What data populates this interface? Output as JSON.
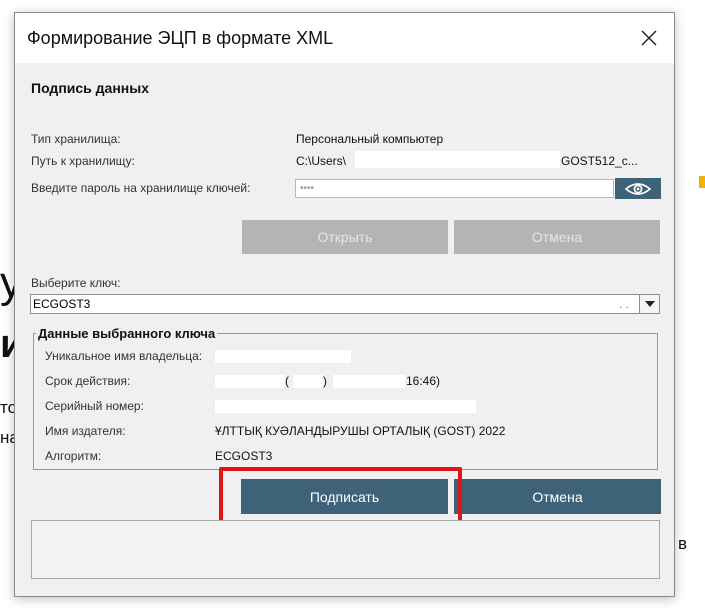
{
  "background": {
    "frag1": "у",
    "frag2": "и",
    "frag3": "то",
    "frag4": "на",
    "frag5": "в"
  },
  "dialog": {
    "title": "Формирование ЭЦП в формате XML",
    "section_title": "Подпись данных",
    "storage": {
      "type_label": "Тип хранилища:",
      "type_value": "Персональный компьютер",
      "path_label": "Путь к хранилищу:",
      "path_value_start": "C:\\Users\\",
      "path_value_end": "GOST512_c...",
      "password_label": "Введите пароль на хранилище ключей:",
      "password_value": "••••"
    },
    "buttons": {
      "open": "Открыть",
      "cancel_top": "Отмена",
      "sign": "Подписать",
      "cancel_bottom": "Отмена"
    },
    "key_select": {
      "label": "Выберите ключ:",
      "value": "ECGOST3",
      "suffix": ". ."
    },
    "key_details": {
      "legend": "Данные выбранного ключа",
      "owner_label": "Уникальное имя владельца:",
      "validity_label": "Срок действия:",
      "validity_mid": "(",
      "validity_paren": ")",
      "validity_time": "16:46)",
      "serial_label": "Серийный номер:",
      "issuer_label": "Имя издателя:",
      "issuer_value": "ҰЛТТЫҚ КУӘЛАНДЫРУШЫ ОРТАЛЫҚ (GOST) 2022",
      "algorithm_label": "Алгоритм:",
      "algorithm_value": "ECGOST3"
    }
  },
  "colors": {
    "accent": "#3e6379",
    "highlight": "#e01515",
    "disabled_button": "#b4b4b4",
    "dialog_bg": "#f0f0f0"
  },
  "icons": {
    "close": "close-icon",
    "eye": "eye-icon",
    "dropdown": "chevron-down-icon"
  }
}
